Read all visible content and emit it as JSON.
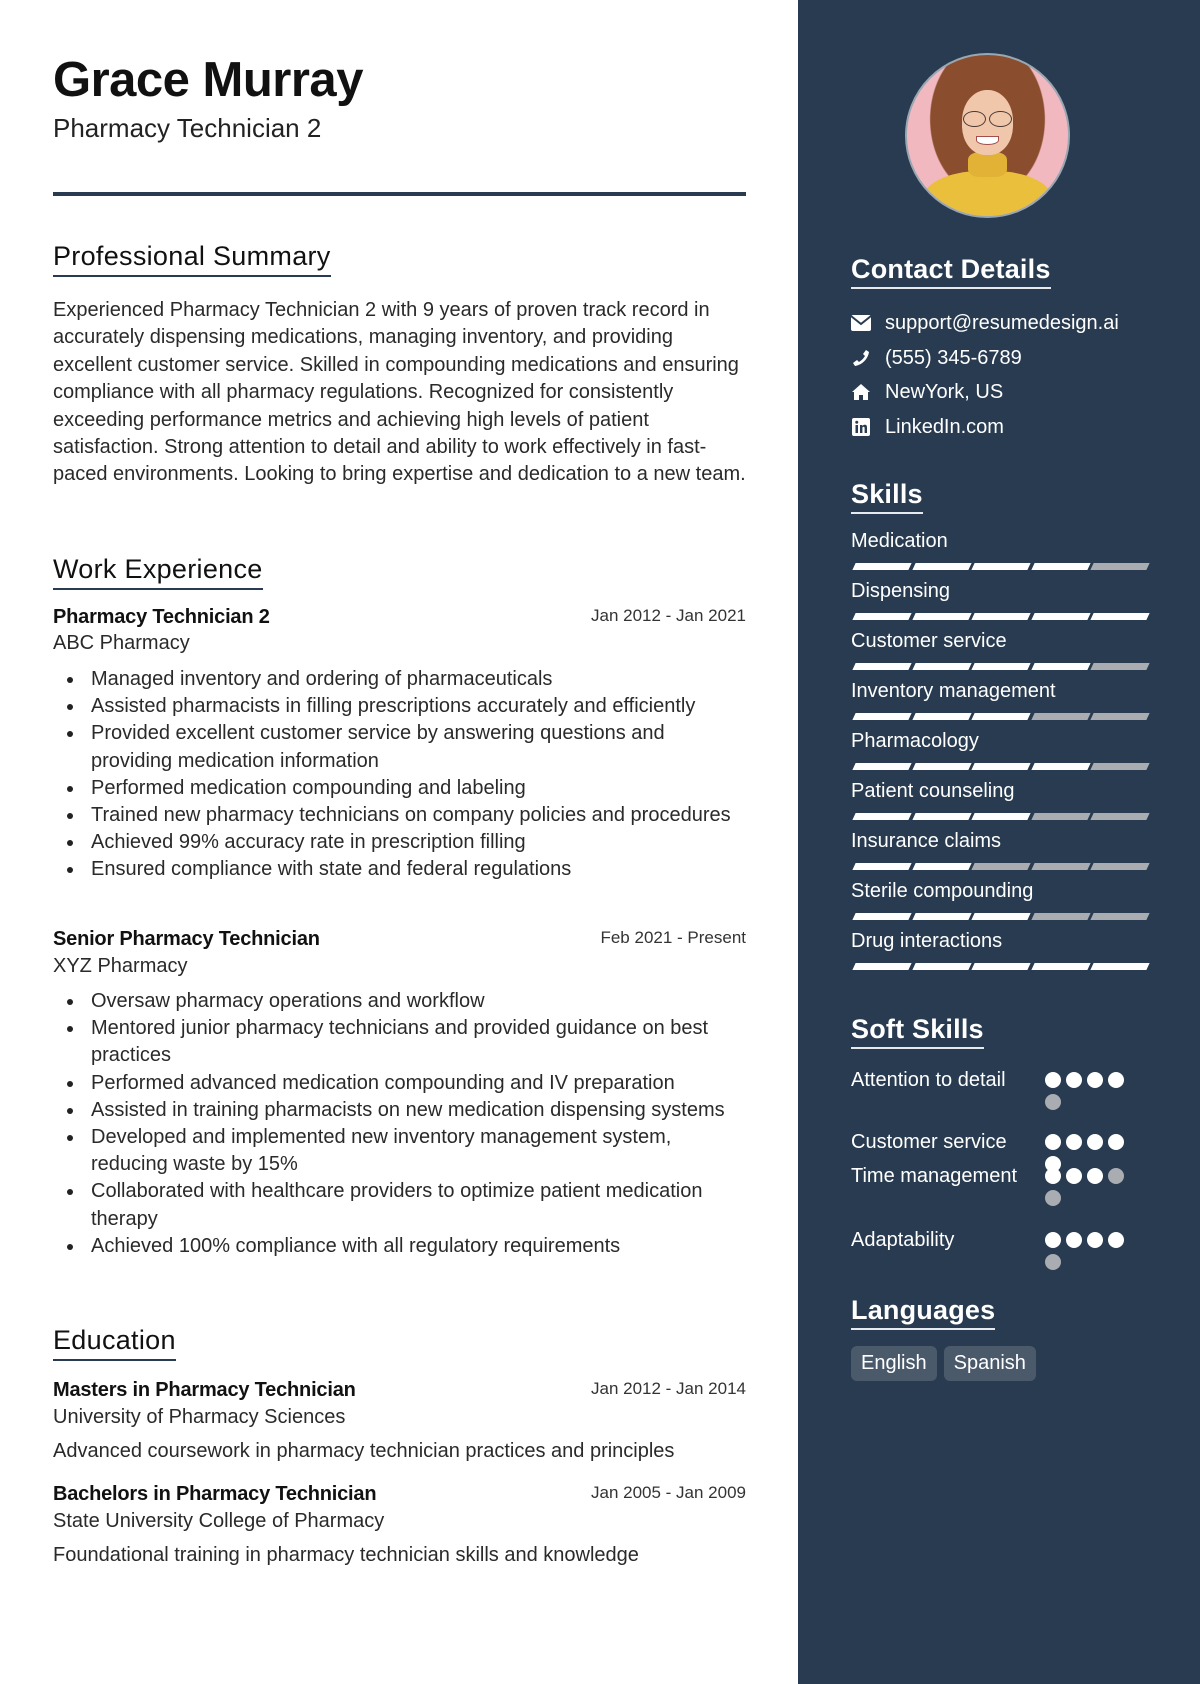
{
  "header": {
    "name": "Grace Murray",
    "title": "Pharmacy Technician 2"
  },
  "sections": {
    "summary_heading": "Professional Summary",
    "experience_heading": "Work Experience",
    "education_heading": "Education",
    "contact_heading": "Contact Details",
    "skills_heading": "Skills",
    "soft_skills_heading": "Soft Skills",
    "languages_heading": "Languages"
  },
  "summary": "Experienced Pharmacy Technician 2 with 9 years of proven track record in accurately dispensing medications, managing inventory, and providing excellent customer service. Skilled in compounding medications and ensuring compliance with all pharmacy regulations. Recognized for consistently exceeding performance metrics and achieving high levels of patient satisfaction. Strong attention to detail and ability to work effectively in fast-paced environments. Looking to bring expertise and dedication to a new team.",
  "experience": [
    {
      "title": "Pharmacy Technician 2",
      "company": "ABC Pharmacy",
      "dates": "Jan 2012 - Jan 2021",
      "bullets": [
        "Managed inventory and ordering of pharmaceuticals",
        "Assisted pharmacists in filling prescriptions accurately and efficiently",
        "Provided excellent customer service by answering questions and providing medication information",
        "Performed medication compounding and labeling",
        "Trained new pharmacy technicians on company policies and procedures",
        "Achieved 99% accuracy rate in prescription filling",
        "Ensured compliance with state and federal regulations"
      ]
    },
    {
      "title": "Senior Pharmacy Technician",
      "company": "XYZ Pharmacy",
      "dates": "Feb 2021 - Present",
      "bullets": [
        "Oversaw pharmacy operations and workflow",
        "Mentored junior pharmacy technicians and provided guidance on best practices",
        "Performed advanced medication compounding and IV preparation",
        "Assisted in training pharmacists on new medication dispensing systems",
        "Developed and implemented new inventory management system, reducing waste by 15%",
        "Collaborated with healthcare providers to optimize patient medication therapy",
        "Achieved 100% compliance with all regulatory requirements"
      ]
    }
  ],
  "education": [
    {
      "degree": "Masters in Pharmacy Technician",
      "school": "University of Pharmacy Sciences",
      "dates": "Jan 2012 - Jan 2014",
      "description": "Advanced coursework in pharmacy technician practices and principles"
    },
    {
      "degree": "Bachelors in Pharmacy Technician",
      "school": "State University College of Pharmacy",
      "dates": "Jan 2005 - Jan 2009",
      "description": "Foundational training in pharmacy technician skills and knowledge"
    }
  ],
  "contact": [
    {
      "icon": "envelope-icon",
      "text": "support@resumedesign.ai"
    },
    {
      "icon": "phone-icon",
      "text": "(555) 345-6789"
    },
    {
      "icon": "home-icon",
      "text": "NewYork, US"
    },
    {
      "icon": "linkedin-icon",
      "text": "LinkedIn.com"
    }
  ],
  "skills": [
    {
      "name": "Medication",
      "level": 4,
      "max": 5
    },
    {
      "name": "Dispensing",
      "level": 5,
      "max": 5
    },
    {
      "name": "Customer service",
      "level": 4,
      "max": 5
    },
    {
      "name": "Inventory management",
      "level": 3,
      "max": 5
    },
    {
      "name": "Pharmacology",
      "level": 4,
      "max": 5
    },
    {
      "name": "Patient counseling",
      "level": 3,
      "max": 5
    },
    {
      "name": "Insurance claims",
      "level": 2,
      "max": 5
    },
    {
      "name": "Sterile compounding",
      "level": 3,
      "max": 5
    },
    {
      "name": "Drug interactions",
      "level": 5,
      "max": 5
    }
  ],
  "soft_skills": [
    {
      "name": "Attention to detail",
      "level": 4,
      "max": 5
    },
    {
      "name": "Customer service",
      "level": 5,
      "max": 5
    },
    {
      "name": "Time management",
      "level": 3,
      "max": 5
    },
    {
      "name": "Adaptability",
      "level": 4,
      "max": 5
    }
  ],
  "languages": [
    "English",
    "Spanish"
  ],
  "colors": {
    "sidebar": "#283b50",
    "accent": "#283b50",
    "rating_on": "#ffffff",
    "rating_off": "#a9adb2",
    "chip": "#4a5a6b"
  }
}
